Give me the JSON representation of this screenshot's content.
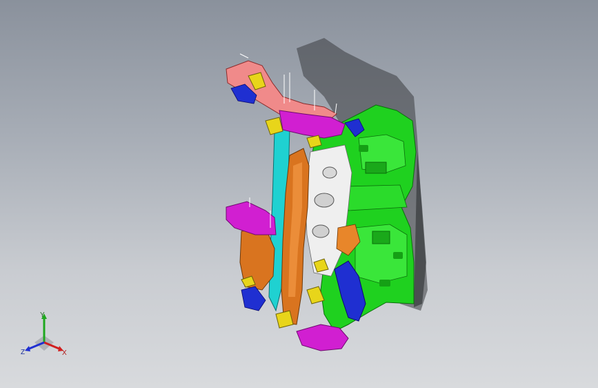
{
  "viewport": {
    "background_top": "#8a919c",
    "background_bottom": "#d8dadd"
  },
  "model": {
    "part_colors": {
      "green": "#1fd11f",
      "orange": "#d9741f",
      "magenta": "#d11fd1",
      "cyan": "#1fd1d1",
      "yellow": "#e8d51a",
      "blue": "#1f2fd1",
      "pink": "#f08a8a",
      "white": "#efefef"
    },
    "shadow_color": "#3a3c40"
  },
  "triad": {
    "x_label": "X",
    "y_label": "Y",
    "z_label": "Z",
    "x_color": "#d11f1f",
    "y_color": "#1fa81f",
    "z_color": "#1f2fd1"
  }
}
